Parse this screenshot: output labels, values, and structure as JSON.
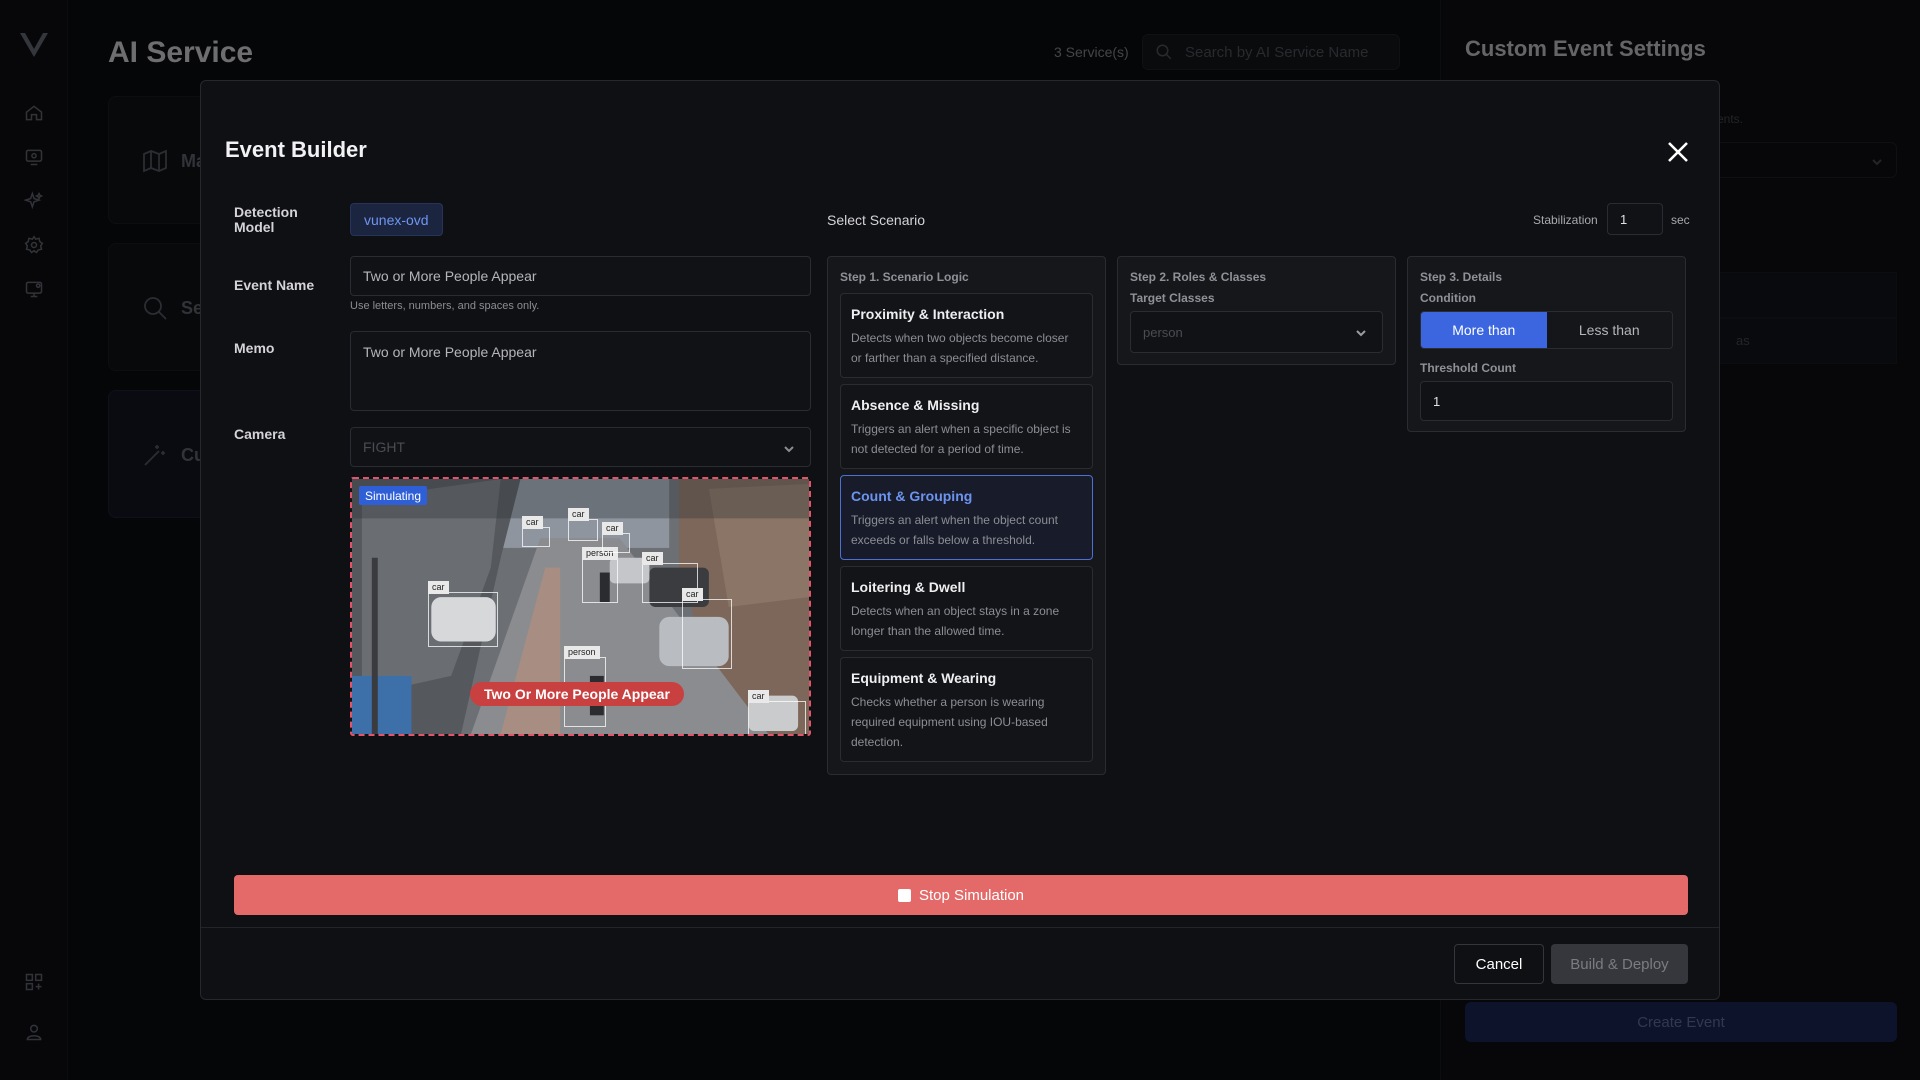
{
  "app": {
    "page_title": "AI Service",
    "service_count": "3 Service(s)",
    "search_placeholder": "Search by AI Service Name",
    "cards": [
      {
        "label": "Ma"
      },
      {
        "label": "Se"
      },
      {
        "label": "Cu"
      }
    ],
    "right_panel": {
      "title": "Custom Event Settings",
      "hint_fragment": "vents.",
      "row_fragment": "as",
      "create_button": "Create Event"
    }
  },
  "modal": {
    "title": "Event Builder",
    "detection_model_label": "Detection Model",
    "detection_model_value": "vunex-ovd",
    "event_name_label": "Event Name",
    "event_name_value": "Two or More People Appear",
    "event_name_hint": "Use letters, numbers, and spaces only.",
    "memo_label": "Memo",
    "memo_value": "Two or More People Appear",
    "camera_label": "Camera",
    "camera_value": "FIGHT",
    "preview": {
      "badge": "Simulating",
      "event_tag": "Two Or More People Appear",
      "detections": [
        "car",
        "car",
        "car",
        "person",
        "car",
        "car",
        "car",
        "person",
        "car"
      ]
    },
    "scenario": {
      "section_title": "Select Scenario",
      "stabilization_label": "Stabilization",
      "stabilization_value": "1",
      "stabilization_unit": "sec",
      "step1": {
        "title": "Step 1. Scenario Logic",
        "items": [
          {
            "title": "Proximity & Interaction",
            "desc": "Detects when two objects become closer or farther than a specified distance."
          },
          {
            "title": "Absence & Missing",
            "desc": "Triggers an alert when a specific object is not detected for a period of time."
          },
          {
            "title": "Count & Grouping",
            "desc": "Triggers an alert when the object count exceeds or falls below a threshold."
          },
          {
            "title": "Loitering & Dwell",
            "desc": "Detects when an object stays in a zone longer than the allowed time."
          },
          {
            "title": "Equipment & Wearing",
            "desc": "Checks whether a person is wearing required equipment using IOU-based detection."
          }
        ],
        "selected_index": 2
      },
      "step2": {
        "title": "Step 2. Roles & Classes",
        "target_label": "Target Classes",
        "target_value": "person"
      },
      "step3": {
        "title": "Step 3. Details",
        "condition_label": "Condition",
        "condition_options": [
          "More than",
          "Less than"
        ],
        "condition_selected": "More than",
        "threshold_label": "Threshold Count",
        "threshold_value": "1"
      }
    },
    "stop_button": "Stop Simulation",
    "cancel_button": "Cancel",
    "deploy_button": "Build & Deploy"
  }
}
